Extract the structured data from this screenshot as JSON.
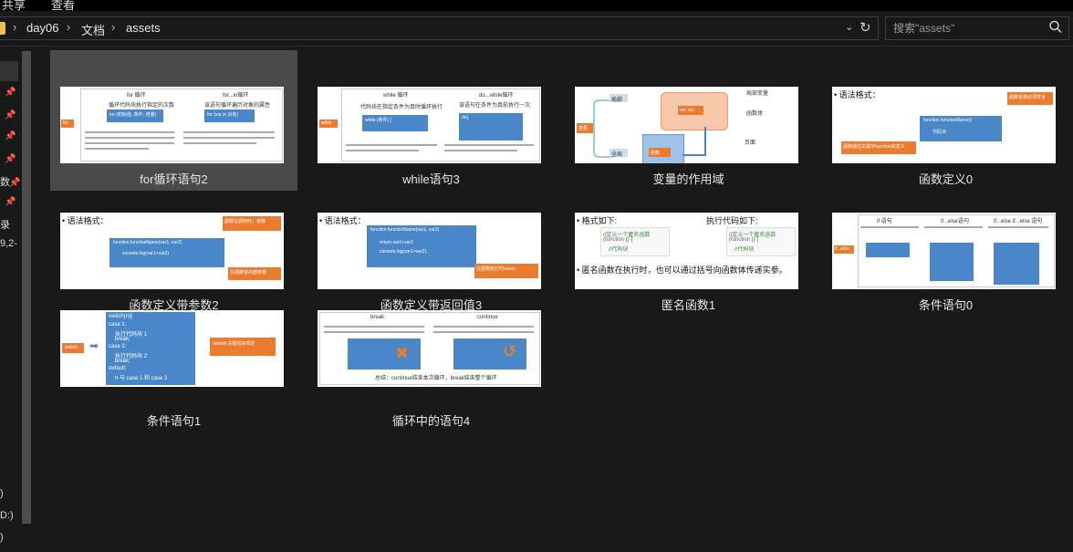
{
  "menu": {
    "items": [
      "共享",
      "查看"
    ]
  },
  "breadcrumb": {
    "items": [
      "day06",
      "文档",
      "assets"
    ],
    "separator": "›"
  },
  "search": {
    "placeholder": "搜索\"assets\""
  },
  "nav": {
    "labels": [
      "数",
      "录",
      "9,2-",
      ")",
      "D:)",
      ")"
    ]
  },
  "icons": {
    "search": "search-icon",
    "refresh": "refresh-icon",
    "dropdown": "chevron-down-icon",
    "pin": "pin-icon",
    "folder": "folder-icon"
  },
  "accent_colors": {
    "slide_blue": "#4a87c8",
    "slide_orange": "#ea7b2f",
    "selected": "#4a4a4a"
  },
  "files": [
    {
      "label": "for循环语句2",
      "slide": {
        "tag": "for",
        "cols": [
          "for 循环",
          "for...in循环"
        ],
        "row1": [
          "循环代码块执行指定的次数",
          "该语句循环遍历对象的属性"
        ],
        "code1": "for (初始值; 条件; 增量)",
        "code2": "for (var in 对象)"
      }
    },
    {
      "label": "while语句3",
      "slide": {
        "tag": "while",
        "cols": [
          "while 循环",
          "do...while循环"
        ],
        "row1": [
          "代码块在指定条件为真时循环执行",
          "该语句在条件为真前执行一次"
        ],
        "code1": "while (条件) {",
        "code2": "do{"
      }
    },
    {
      "label": "变量的作用域",
      "slide": {
        "left": "变量",
        "upper": "局部",
        "lower": "全局",
        "right_top": "局部变量",
        "right_mid": "函数体",
        "right_bottom": "页面",
        "box1": "var xxx",
        "box2": "函数"
      }
    },
    {
      "label": "函数定义0",
      "slide": {
        "title": "• 语法格式：",
        "code": "function   functionName()",
        "body": "代码块",
        "note": "函数名称必须符合变量命名规则"
      }
    },
    {
      "label": "函数定义带参数2",
      "slide": {
        "title": "• 语法格式：",
        "code": "function  functionName(var1, var2)",
        "body": "console.log(var1+var2)",
        "note": "函数在调用时，参数的顺序必须与定义时一致"
      }
    },
    {
      "label": "函数定义带返回值3",
      "slide": {
        "title": "• 语法格式：",
        "code": "function  functionName(var1, var2)",
        "body": "return var1+var2",
        "note": "在函数执行时return语句后面的代码不会执行"
      }
    },
    {
      "label": "匿名函数1",
      "slide": {
        "left_title": "• 格式如下:",
        "right_title": "执行代码如下:",
        "left_code": "//定义一个匿名函数",
        "right_code": "//定义一个匿名函数",
        "footer": "• 匿名函数在执行时，也可以通过括号向函数体传递实参。"
      }
    },
    {
      "label": "条件语句0",
      "slide": {
        "tag": "if...else",
        "cols": [
          "if 语句",
          "if...else语句",
          "if...else if...else 语句"
        ]
      }
    },
    {
      "label": "条件语句1",
      "slide": {
        "tag": "switch",
        "code": "switch(n){",
        "cases": [
          "case 1:",
          "执行代码块 1",
          "break;",
          "case 2:",
          "执行代码块 2",
          "break;",
          "default:",
          "n 与 case 1 和 case 2 不同时执行的代码"
        ],
        "note": "default 关键词来规定匹配不存在时执行的代码"
      }
    },
    {
      "label": "循环中的语句4",
      "slide": {
        "cols": [
          "break",
          "continue"
        ],
        "footer": "总结：continue结束本次循环，break结束整个循环"
      }
    }
  ]
}
